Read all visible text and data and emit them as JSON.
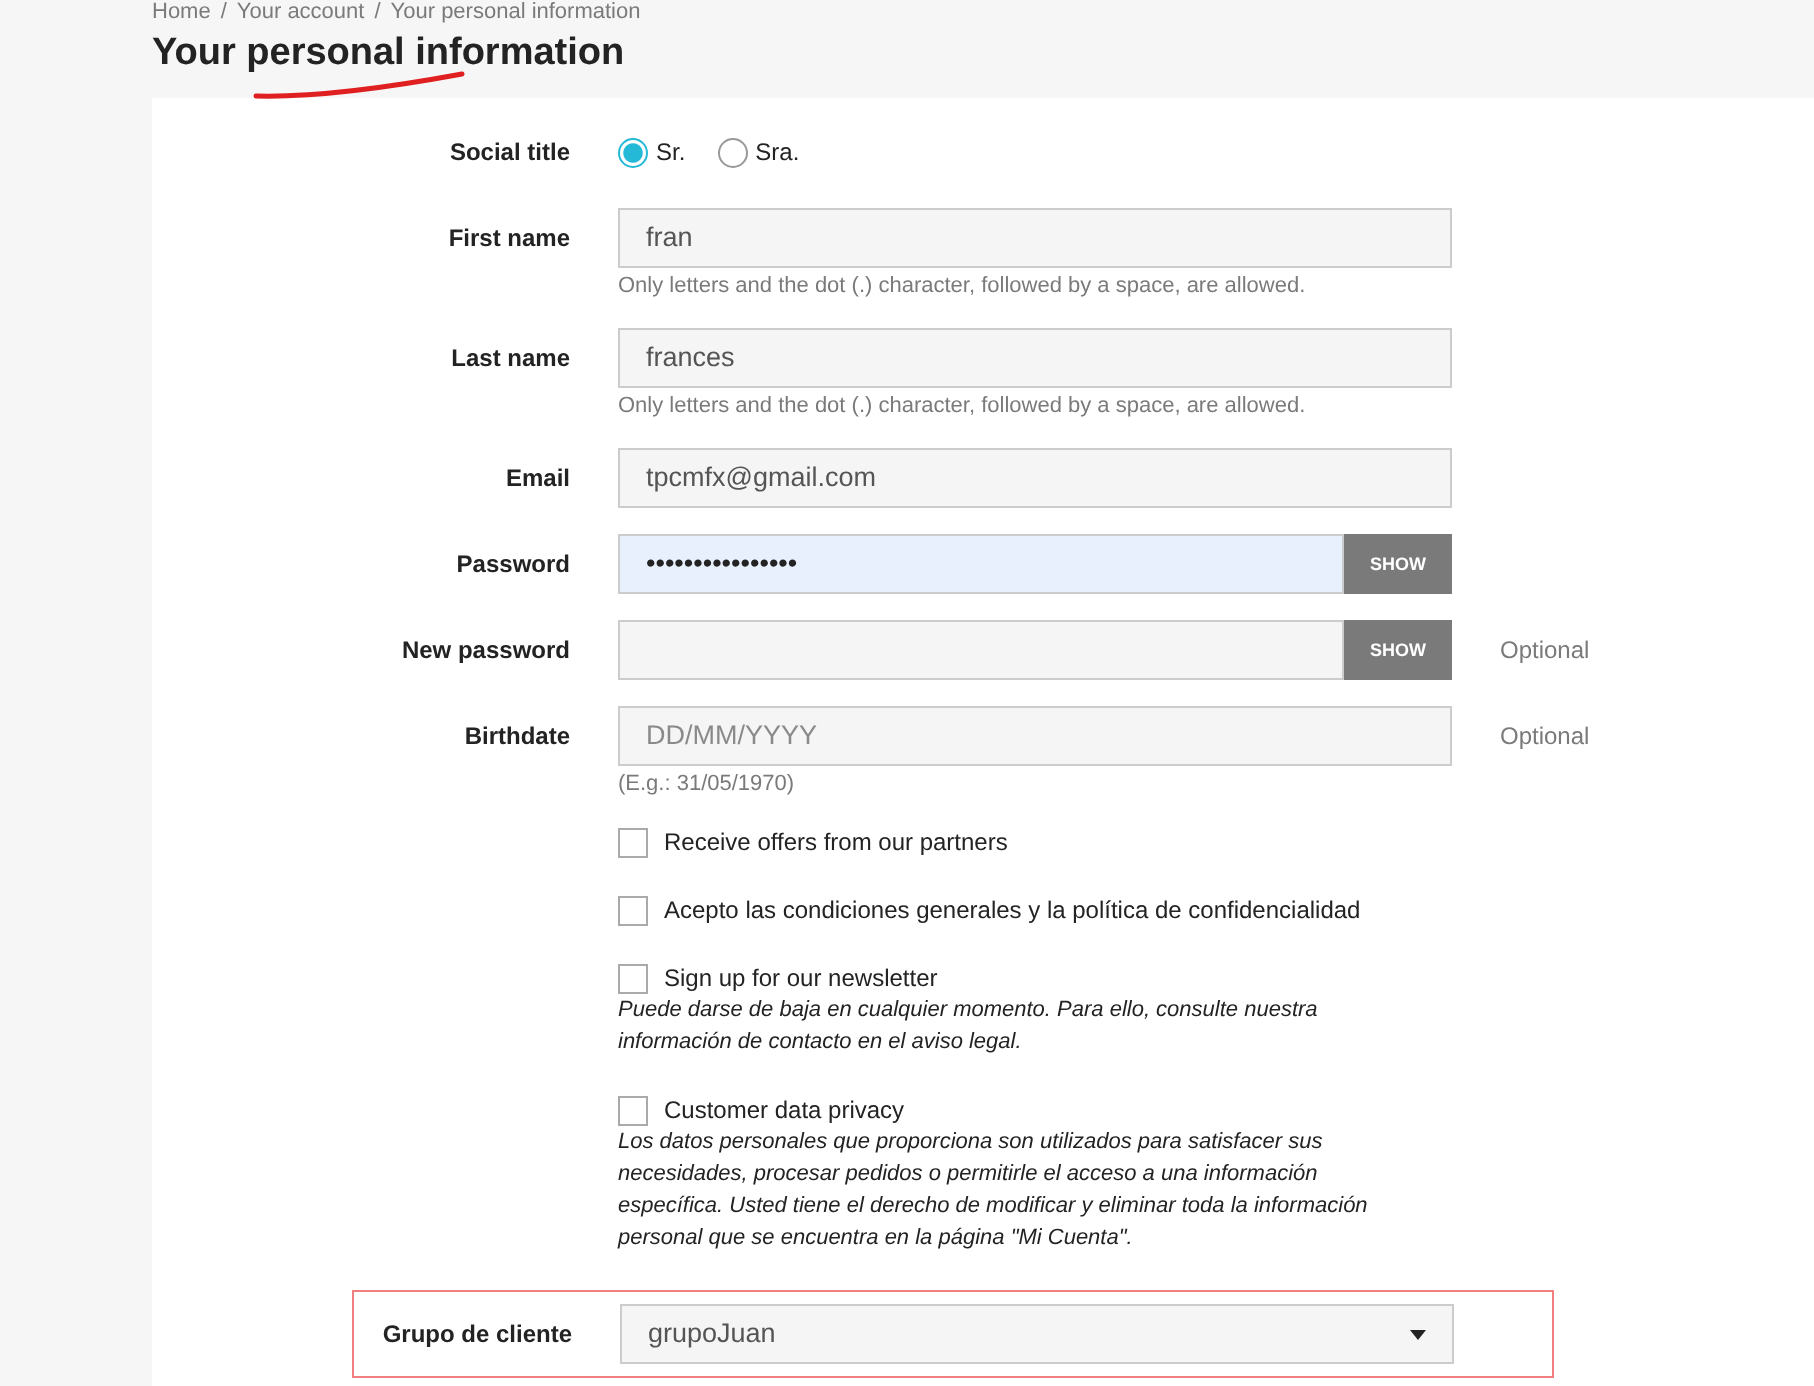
{
  "breadcrumb": {
    "items": [
      "Home",
      "Your account",
      "Your personal information"
    ],
    "separator": "/"
  },
  "title": {
    "text": "Your personal information",
    "underlined": true
  },
  "fields": [
    {
      "kind": "radio",
      "label": "Social title",
      "options": [
        {
          "label": "Sr.",
          "selected": true
        },
        {
          "label": "Sra.",
          "selected": false
        }
      ]
    },
    {
      "kind": "text",
      "label": "First name",
      "value": "fran",
      "help": "Only letters and the dot (.) character, followed by a space, are allowed."
    },
    {
      "kind": "text",
      "label": "Last name",
      "value": "frances",
      "help": "Only letters and the dot (.) character, followed by a space, are allowed."
    },
    {
      "kind": "text",
      "label": "Email",
      "value": "tpcmfx@gmail.com"
    },
    {
      "kind": "password",
      "label": "Password",
      "value": "••••••••••••••••",
      "button": "SHOW",
      "focused": true
    },
    {
      "kind": "password",
      "label": "New password",
      "button": "SHOW",
      "note": "Optional",
      "focused": false
    },
    {
      "kind": "text",
      "label": "Birthdate",
      "placeholder": "DD/MM/YYYY",
      "note": "Optional",
      "help": "(E.g.: 31/05/1970)"
    },
    {
      "kind": "checkbox",
      "label": "Receive offers from our partners",
      "checked": false
    },
    {
      "kind": "checkbox",
      "label": "Acepto las condiciones generales y la política de confidencialidad",
      "checked": false
    },
    {
      "kind": "checkbox",
      "label": "Sign up for our newsletter",
      "checked": false,
      "help": "Puede darse de baja en cualquier momento. Para ello, consulte nuestra información de contacto en el aviso legal."
    },
    {
      "kind": "checkbox",
      "label": "Customer data privacy",
      "checked": false,
      "help": "Los datos personales que proporciona son utilizados para satisfacer sus necesidades, procesar pedidos o permitirle el acceso a una información específica. Usted tiene el derecho de modificar y eliminar toda la información personal que se encuentra en la página \"Mi Cuenta\"."
    },
    {
      "kind": "select",
      "label": "Grupo de cliente",
      "value": "grupoJuan",
      "highlighted": true
    }
  ]
}
